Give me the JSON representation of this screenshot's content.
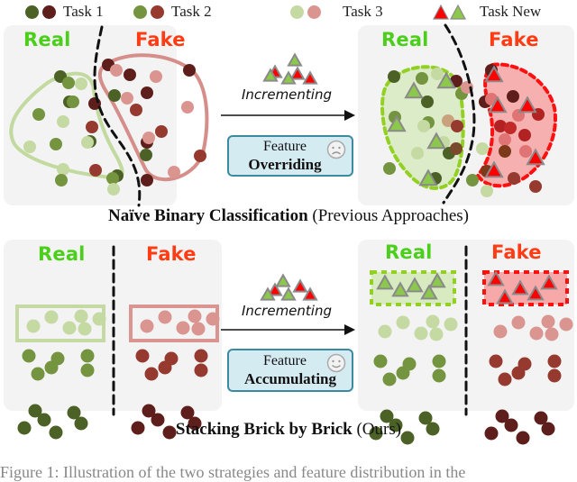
{
  "legend": [
    {
      "label": "Task 1",
      "icon": "circle-pair",
      "colors": [
        "#4b6125",
        "#5e1f1c"
      ]
    },
    {
      "label": "Task 2",
      "icon": "circle-pair",
      "colors": [
        "#749440",
        "#963a30"
      ]
    },
    {
      "label": "Task 3",
      "icon": "circle-pair",
      "colors": [
        "#c5d9a2",
        "#db9590"
      ]
    },
    {
      "label": "Task New",
      "icon": "triangle-pair",
      "colors": [
        "#ff0000",
        "#8cc84b"
      ]
    }
  ],
  "colors": {
    "real_label": "#4ccf1b",
    "fake_label": "#ff3c14",
    "real_t1": "#4b6125",
    "real_t2": "#749440",
    "real_t3": "#c5d9a2",
    "fake_t1": "#5e1f1c",
    "fake_t2": "#963a30",
    "fake_t3": "#db9590",
    "new_real": "#8cc84b",
    "new_fake": "#ff0000",
    "box_fill": "#d5ebf2",
    "box_border": "#3c8aa0"
  },
  "top": {
    "left_panel": {
      "real_label": "Real",
      "fake_label": "Fake"
    },
    "right_panel": {
      "real_label": "Real",
      "fake_label": "Fake"
    },
    "arrow_label": "Incrementing",
    "feature_box": {
      "line1": "Feature",
      "line2": "Overriding",
      "face": "sad-face-icon"
    },
    "title_bold": "Naïve Binary Classification",
    "title_normal": " (Previous Approaches)"
  },
  "bottom": {
    "left_panel": {
      "real_label": "Real",
      "fake_label": "Fake"
    },
    "right_panel": {
      "real_label": "Real",
      "fake_label": "Fake"
    },
    "arrow_label": "Incrementing",
    "feature_box": {
      "line1": "Feature",
      "line2": "Accumulating",
      "face": "smile-face-icon"
    },
    "title_bold": "Stacking Brick by Brick",
    "title_normal": " (Ours)"
  },
  "caption": "Figure 1: Illustration of the two strategies and feature distribution in the"
}
